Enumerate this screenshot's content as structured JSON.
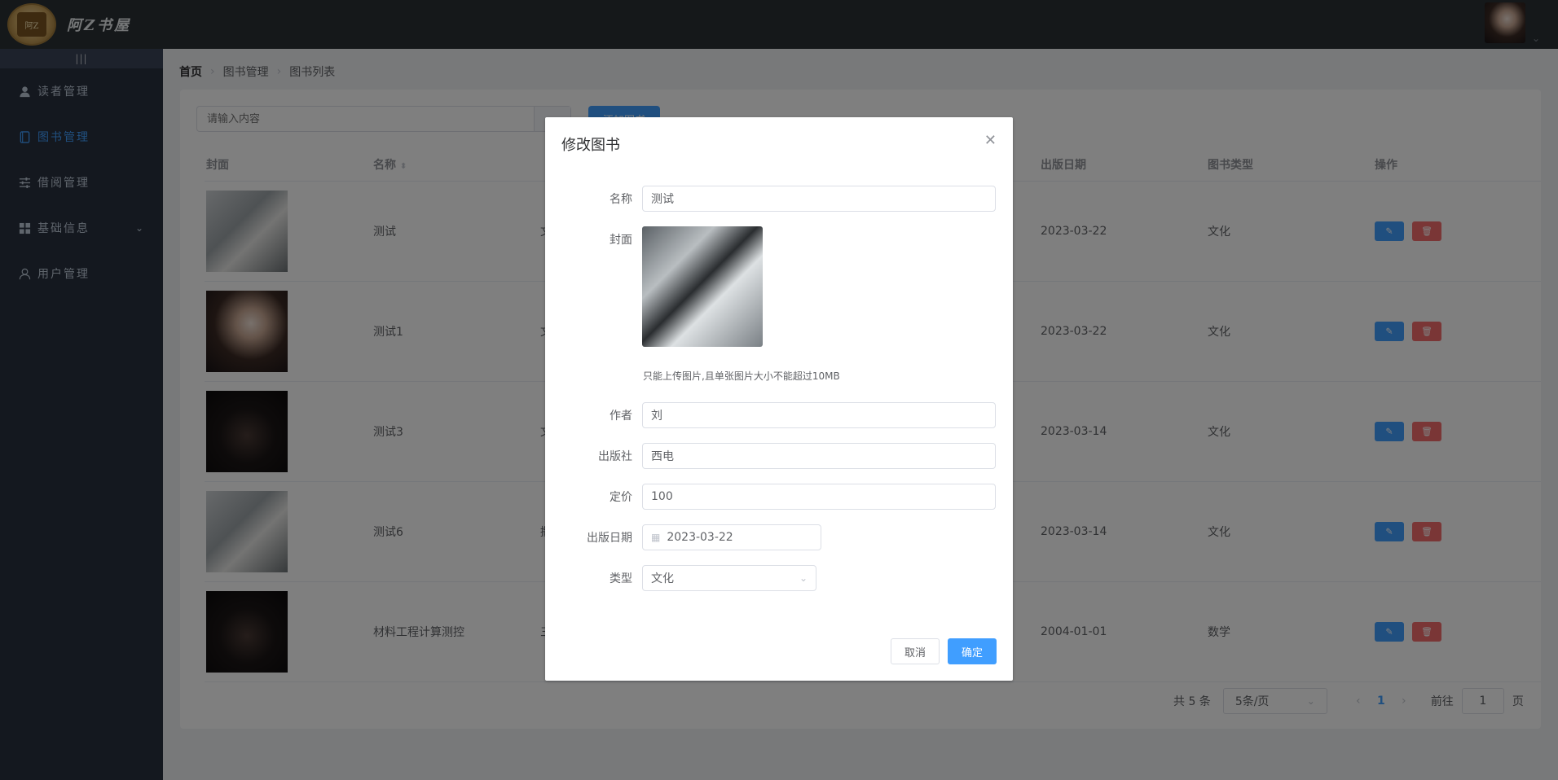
{
  "header": {
    "brand": "阿Z书屋",
    "logo_text": "阿Z"
  },
  "sidebar": {
    "toggle": "|||",
    "items": [
      {
        "label": "读者管理",
        "icon": "user-icon"
      },
      {
        "label": "图书管理",
        "icon": "book-icon",
        "active": true
      },
      {
        "label": "借阅管理",
        "icon": "sliders-icon"
      },
      {
        "label": "基础信息",
        "icon": "grid-icon",
        "expandable": true
      },
      {
        "label": "用户管理",
        "icon": "user-outline-icon"
      }
    ]
  },
  "breadcrumb": {
    "home": "首页",
    "level1": "图书管理",
    "level2": "图书列表"
  },
  "search": {
    "placeholder": "请输入内容"
  },
  "add_button": "添加图书",
  "table": {
    "headers": {
      "cover": "封面",
      "name": "名称",
      "pub_date": "出版日期",
      "type": "图书类型",
      "ops": "操作"
    },
    "rows": [
      {
        "name": "测试",
        "partial": "文",
        "pub_date": "2023-03-22",
        "type": "文化"
      },
      {
        "name": "测试1",
        "partial": "文",
        "pub_date": "2023-03-22",
        "type": "文化"
      },
      {
        "name": "测试3",
        "partial": "文",
        "pub_date": "2023-03-14",
        "type": "文化"
      },
      {
        "name": "测试6",
        "partial": "撒",
        "pub_date": "2023-03-14",
        "type": "文化"
      },
      {
        "name": "材料工程计算测控",
        "partial": "三",
        "pub_date": "2004-01-01",
        "type": "数学"
      }
    ]
  },
  "pagination": {
    "total": "共 5 条",
    "size": "5条/页",
    "current": "1",
    "goto_prefix": "前往",
    "goto_value": "1",
    "goto_suffix": "页"
  },
  "dialog": {
    "title": "修改图书",
    "fields": {
      "name_label": "名称",
      "name_value": "测试",
      "cover_label": "封面",
      "upload_tip": "只能上传图片,且单张图片大小不能超过10MB",
      "author_label": "作者",
      "author_value": "刘",
      "publisher_label": "出版社",
      "publisher_value": "西电",
      "price_label": "定价",
      "price_value": "100",
      "date_label": "出版日期",
      "date_value": "2023-03-22",
      "type_label": "类型",
      "type_value": "文化"
    },
    "cancel": "取消",
    "confirm": "确定"
  },
  "colors": {
    "primary": "#409eff",
    "danger": "#f56c6c",
    "sidebar": "#28303f",
    "header": "#2b3035"
  }
}
